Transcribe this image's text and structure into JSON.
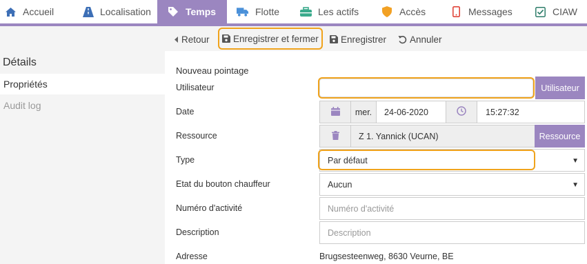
{
  "nav": {
    "items": [
      {
        "label": "Accueil",
        "icon": "home-icon"
      },
      {
        "label": "Localisation",
        "icon": "road-icon"
      },
      {
        "label": "Temps",
        "icon": "tag-icon"
      },
      {
        "label": "Flotte",
        "icon": "truck-icon"
      },
      {
        "label": "Les actifs",
        "icon": "toolbox-icon"
      },
      {
        "label": "Accès",
        "icon": "shield-icon"
      },
      {
        "label": "Messages",
        "icon": "mobile-icon"
      },
      {
        "label": "CIAW",
        "icon": "checkbox-icon"
      }
    ],
    "active": "Temps",
    "accent_color": "#9b86c0"
  },
  "sidebar": {
    "heading": "Détails",
    "items": [
      "Propriétés",
      "Audit log"
    ]
  },
  "toolbar": {
    "back_label": "Retour",
    "save_close_label": "Enregistrer et fermer",
    "save_label": "Enregistrer",
    "cancel_label": "Annuler",
    "highlight_color": "#f0a31c"
  },
  "form": {
    "title": "Nouveau pointage",
    "user_label": "Utilisateur",
    "user_value": "",
    "user_button": "Utilisateur",
    "date_label": "Date",
    "date_day": "mer.",
    "date_value": "24-06-2020",
    "time_value": "15:27:32",
    "resource_label": "Ressource",
    "resource_value": "Z 1. Yannick (UCAN)",
    "resource_button": "Ressource",
    "type_label": "Type",
    "type_value": "Par défaut",
    "driver_button_label": "Etat du bouton chauffeur",
    "driver_button_value": "Aucun",
    "activity_label": "Numéro d'activité",
    "activity_placeholder": "Numéro d'activité",
    "description_label": "Description",
    "description_placeholder": "Description",
    "address_label": "Adresse",
    "address_value": "Brugsesteenweg, 8630 Veurne, BE"
  }
}
